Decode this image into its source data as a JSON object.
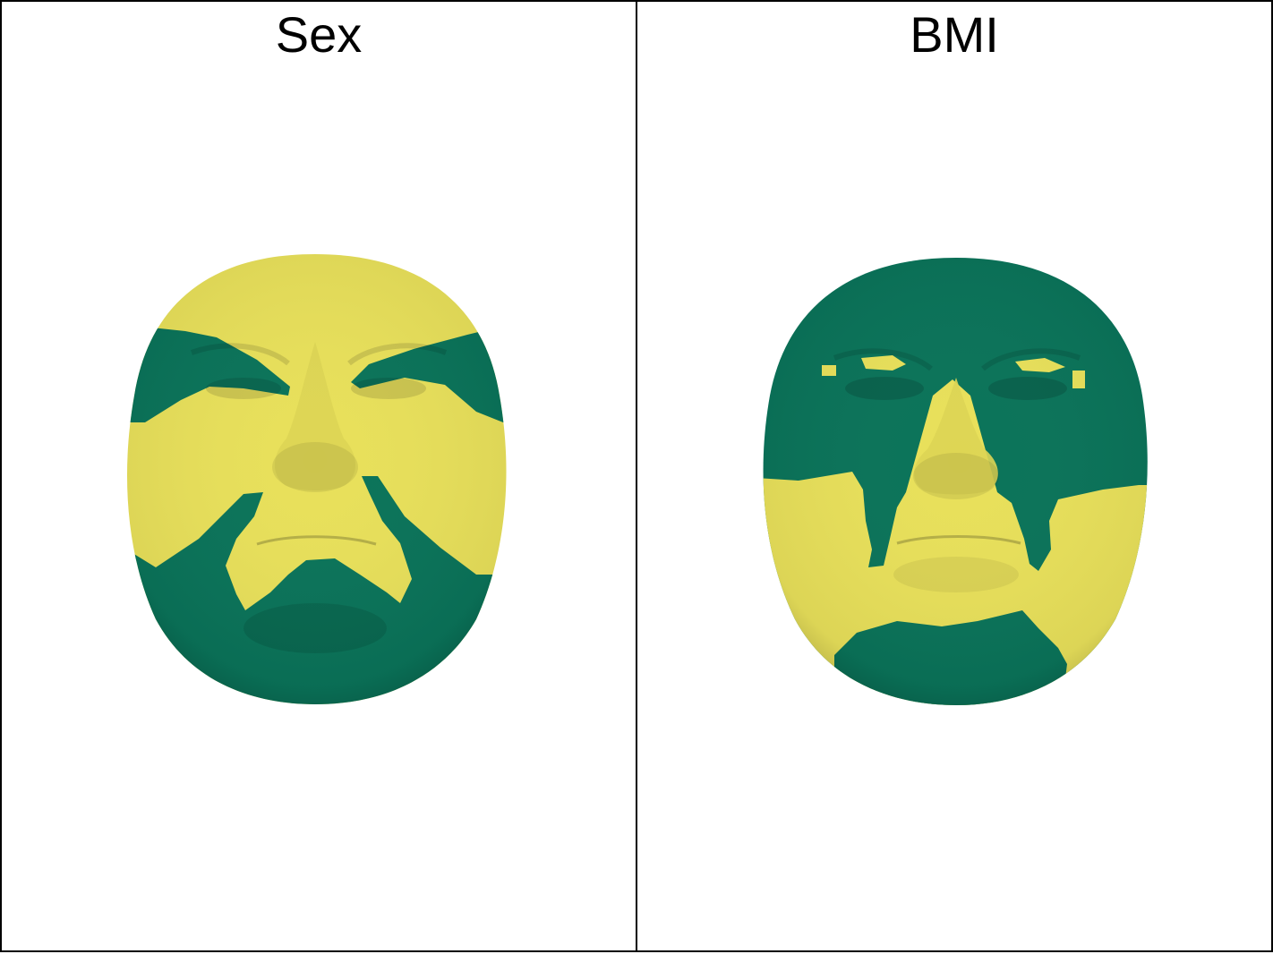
{
  "panels": [
    {
      "id": "sex",
      "title": "Sex"
    },
    {
      "id": "bmi",
      "title": "BMI"
    }
  ],
  "colors": {
    "yellow": "#e8e05a",
    "green": "#0a7359",
    "border": "#000000",
    "background": "#ffffff"
  }
}
